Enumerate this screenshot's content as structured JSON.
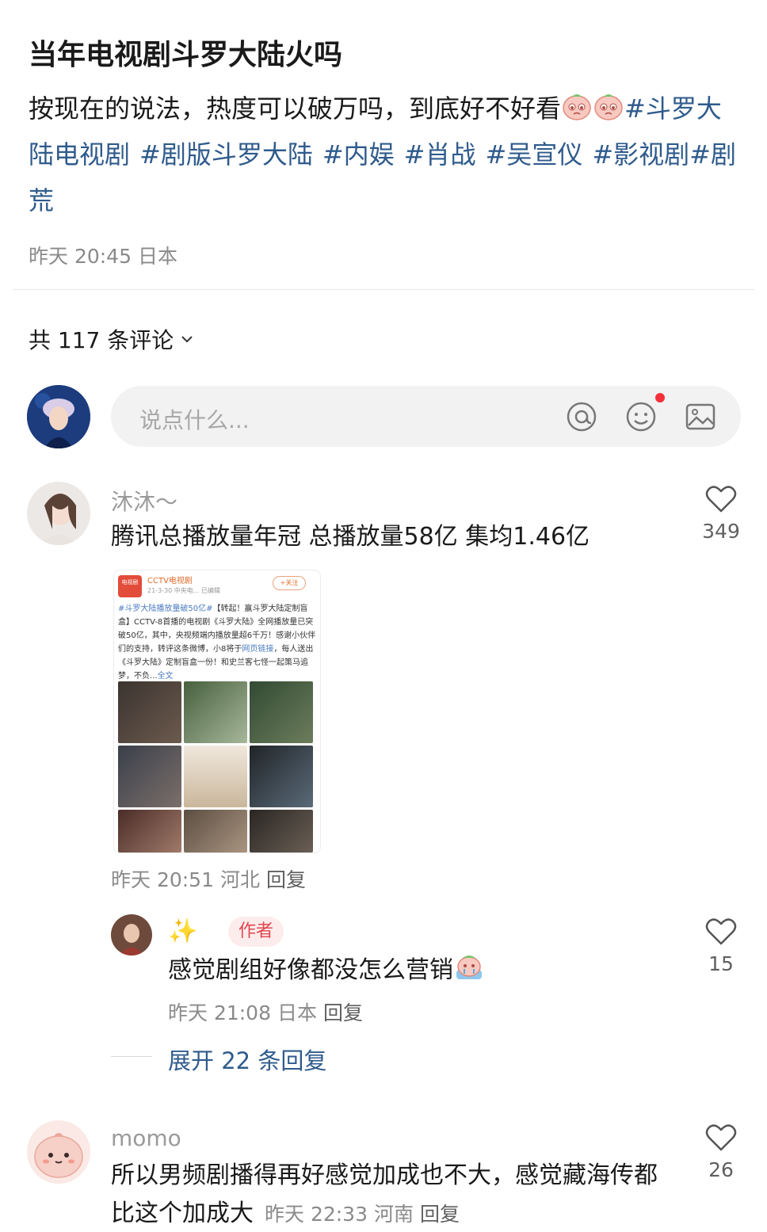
{
  "post": {
    "title": "当年电视剧斗罗大陆火吗",
    "body_text": "按现在的说法，热度可以破万吗，到底好不好看",
    "hashtags": [
      "#斗罗大陆电视剧",
      "#剧版斗罗大陆",
      "#内娱",
      "#肖战",
      "#吴宣仪",
      "#影视剧",
      "#剧荒"
    ],
    "meta": {
      "time": "昨天 20:45",
      "location": "日本"
    }
  },
  "comments_header": {
    "count_label": "共 117 条评论"
  },
  "composer": {
    "placeholder": "说点什么..."
  },
  "comments": [
    {
      "username": "沐沐～",
      "text": "腾讯总播放量年冠 总播放量58亿 集均1.46亿",
      "likes": "349",
      "time": "昨天 20:51",
      "location": "河北",
      "reply_label": "回复",
      "image_card": {
        "account": "CCTV电视剧",
        "logo_text": "电视剧",
        "subline": "21-3-30  中央电...  已编辑",
        "follow": "+关注",
        "tag": "#斗罗大陆播放量破50亿#",
        "text": "【转起！赢斗罗大陆定制盲盒】CCTV-8首播的电视剧《斗罗大陆》全网播放量已突破50亿，其中，央视频端内播放量超6千万！感谢小伙伴们的支持，转评这条微博，小8将于",
        "link": "网页链接",
        "text2": "，每人送出《斗罗大陆》定制盲盒一份！和史兰客七怪一起策马追梦，不负...",
        "more": "全文"
      }
    },
    {
      "username": "✨",
      "badge": "作者",
      "text": "感觉剧组好像都没怎么营销",
      "likes": "15",
      "time": "昨天 21:08",
      "location": "日本",
      "reply_label": "回复"
    },
    {
      "username": "momo",
      "text_line1": "所以男频剧播得再好感觉加成也不大，感觉藏海传都",
      "text_line2": "比这个加成大",
      "likes": "26",
      "time": "昨天 22:33",
      "location": "河南",
      "reply_label": "回复"
    }
  ],
  "expand_replies": "展开 22 条回复",
  "colors": {
    "link_blue": "#2f5b8c",
    "badge_red": "#e0474f",
    "meta_gray": "#8a8a8a",
    "notif_red": "#f2323b"
  }
}
